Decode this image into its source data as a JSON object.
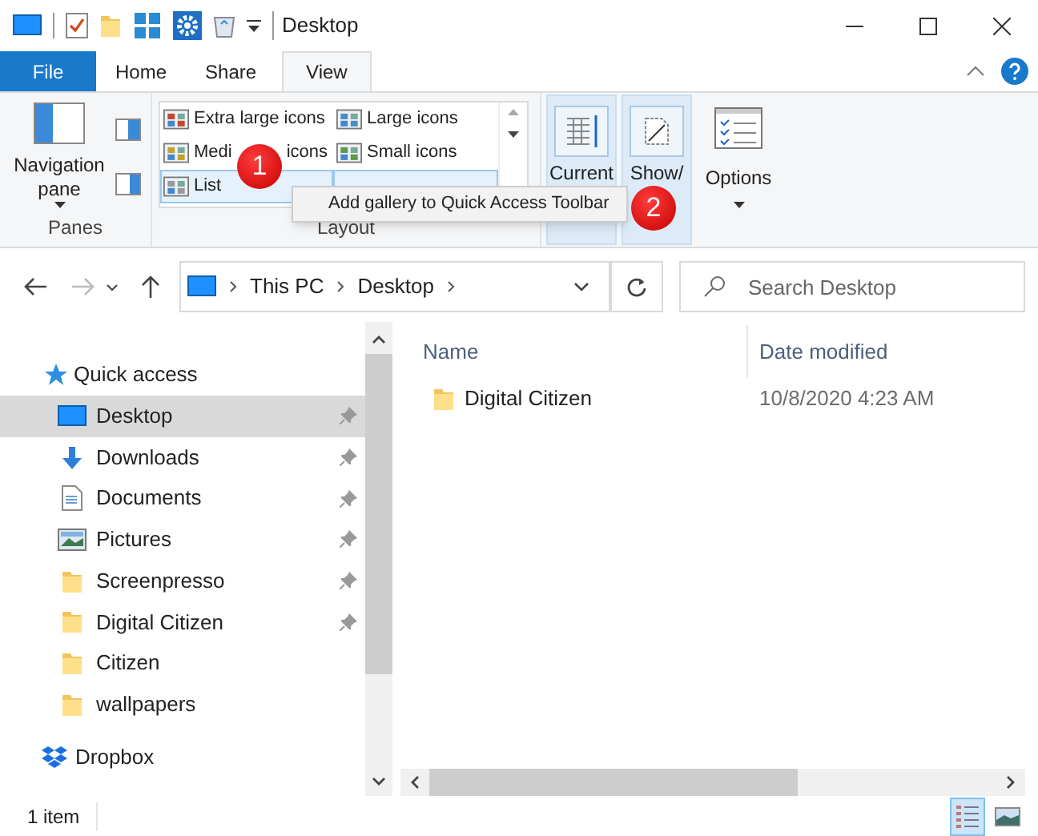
{
  "title_bar": {
    "title": "Desktop"
  },
  "tabs": [
    {
      "label": "File",
      "kind": "file",
      "selected": false
    },
    {
      "label": "Home",
      "kind": "tab",
      "selected": false
    },
    {
      "label": "Share",
      "kind": "tab",
      "selected": false
    },
    {
      "label": "View",
      "kind": "tab",
      "selected": true
    }
  ],
  "ribbon": {
    "panes": {
      "label": "Panes",
      "navigation_pane": "Navigation pane"
    },
    "layout": {
      "label": "Layout",
      "items": [
        {
          "label": "Extra large icons",
          "highlighted": false
        },
        {
          "label": "Large icons",
          "highlighted": false
        },
        {
          "label": "Medi",
          "label_after": "icons",
          "highlighted": false
        },
        {
          "label": "Small icons",
          "highlighted": false
        },
        {
          "label": "List",
          "highlighted": true
        },
        {
          "highlighted": true
        }
      ]
    },
    "current_view": {
      "label": "Current"
    },
    "show_hide": {
      "label": "Show/"
    },
    "options": {
      "label": "Options"
    }
  },
  "context_menu": {
    "items": [
      "Add gallery to Quick Access Toolbar"
    ]
  },
  "badges": [
    "1",
    "2"
  ],
  "address_bar": {
    "path": [
      "This PC",
      "Desktop"
    ]
  },
  "search": {
    "placeholder": "Search Desktop"
  },
  "navigation": {
    "header": "Quick access",
    "items": [
      {
        "label": "Desktop",
        "kind": "desktop",
        "pinned": true,
        "selected": true
      },
      {
        "label": "Downloads",
        "kind": "downloads",
        "pinned": true,
        "selected": false
      },
      {
        "label": "Documents",
        "kind": "documents",
        "pinned": true,
        "selected": false
      },
      {
        "label": "Pictures",
        "kind": "pictures",
        "pinned": true,
        "selected": false
      },
      {
        "label": "Screenpresso",
        "kind": "folder",
        "pinned": true,
        "selected": false
      },
      {
        "label": "Digital Citizen",
        "kind": "folder",
        "pinned": true,
        "selected": false
      },
      {
        "label": "Citizen",
        "kind": "folder",
        "pinned": false,
        "selected": false
      },
      {
        "label": "wallpapers",
        "kind": "folder",
        "pinned": false,
        "selected": false
      }
    ],
    "footer": "Dropbox"
  },
  "file_list": {
    "columns": [
      "Name",
      "Date modified"
    ],
    "rows": [
      {
        "name": "Digital Citizen",
        "date": "10/8/2020 4:23 AM"
      }
    ]
  },
  "status_bar": {
    "text": "1 item",
    "views": [
      {
        "kind": "details",
        "selected": true
      },
      {
        "kind": "large",
        "selected": false
      }
    ]
  }
}
